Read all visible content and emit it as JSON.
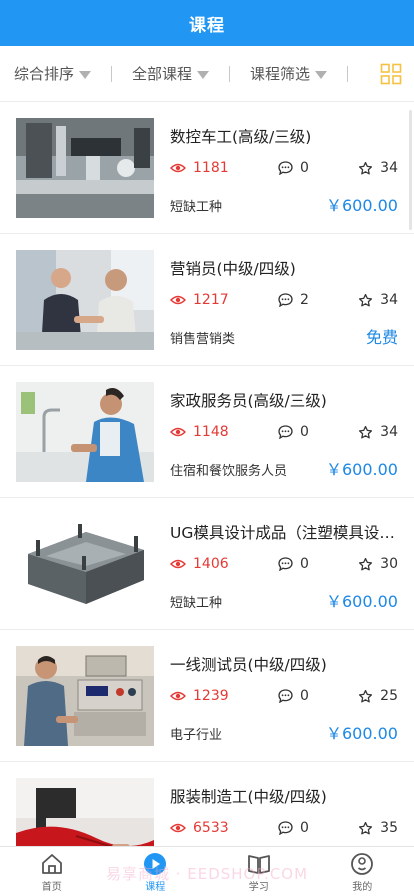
{
  "header": {
    "title": "课程"
  },
  "filters": [
    {
      "label": "综合排序"
    },
    {
      "label": "全部课程"
    },
    {
      "label": "课程筛选"
    }
  ],
  "courses": [
    {
      "title": "数控车工(高级/三级)",
      "views": "1181",
      "comments": "0",
      "favorites": "34",
      "category": "短缺工种",
      "price": "￥600.00",
      "image": "cnc-machine-photo"
    },
    {
      "title": "营销员(中级/四级)",
      "views": "1217",
      "comments": "2",
      "favorites": "34",
      "category": "销售营销类",
      "price": "免费",
      "image": "handshake-photo"
    },
    {
      "title": "家政服务员(高级/三级)",
      "views": "1148",
      "comments": "0",
      "favorites": "34",
      "category": "住宿和餐饮服务人员",
      "price": "￥600.00",
      "image": "housekeeping-photo"
    },
    {
      "title": "UG模具设计成品（注塑模具设…",
      "views": "1406",
      "comments": "0",
      "favorites": "30",
      "category": "短缺工种",
      "price": "￥600.00",
      "image": "injection-mold-photo"
    },
    {
      "title": "一线测试员(中级/四级)",
      "views": "1239",
      "comments": "0",
      "favorites": "25",
      "category": "电子行业",
      "price": "￥600.00",
      "image": "electronics-tester-photo"
    },
    {
      "title": "服装制造工(中级/四级)",
      "views": "6533",
      "comments": "0",
      "favorites": "35",
      "category": "",
      "price": "",
      "image": "sewing-machine-photo"
    }
  ],
  "nav": [
    {
      "label": "首页",
      "icon": "home-icon"
    },
    {
      "label": "课程",
      "icon": "course-play-icon"
    },
    {
      "label": "学习",
      "icon": "book-icon"
    },
    {
      "label": "我的",
      "icon": "profile-icon"
    }
  ],
  "watermark": "易享商城 · EEDSHOP.COM",
  "colors": {
    "primary": "#2196f3",
    "views": "#e53935",
    "price": "#1e88e5"
  }
}
